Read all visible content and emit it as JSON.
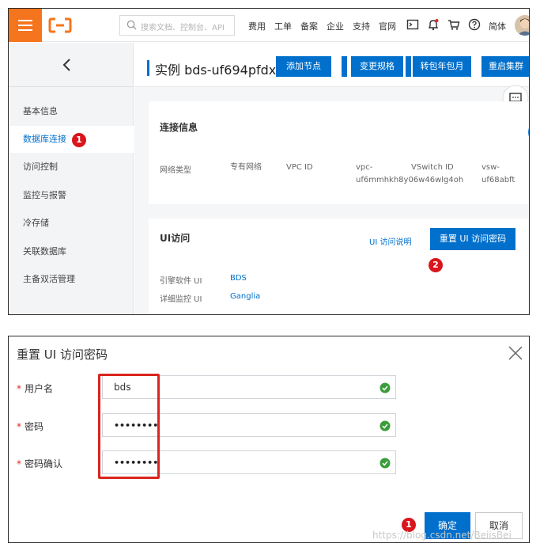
{
  "topnav": {
    "search_placeholder": "搜索文档、控制台、API",
    "links": [
      "费用",
      "工单",
      "备案",
      "企业",
      "支持",
      "官网"
    ],
    "lang": "简体",
    "icons": [
      "terminal-icon",
      "bell-icon",
      "cart-icon",
      "help-icon"
    ]
  },
  "sidebar": {
    "items": [
      {
        "label": "基本信息"
      },
      {
        "label": "数据库连接"
      },
      {
        "label": "访问控制"
      },
      {
        "label": "监控与报警"
      },
      {
        "label": "冷存储"
      },
      {
        "label": "关联数据库"
      },
      {
        "label": "主备双活管理"
      }
    ],
    "active_index": 1
  },
  "header": {
    "instance_title": "实例 bds-uf694pfdx5i5",
    "buttons": {
      "add_node": "添加节点",
      "change_spec": "变更规格",
      "to_annual": "转包年包月",
      "restart": "重启集群"
    }
  },
  "connection": {
    "title": "连接信息",
    "network_type_label": "网络类型",
    "network_type_value": "专有网络",
    "vpc_label": "VPC ID",
    "vpc_value_1": "vpc-",
    "vpc_value_2": "uf6mmhkh8y06w46wlg4oh",
    "vswitch_label": "VSwitch ID",
    "vswitch_value_1": "vsw-",
    "vswitch_value_2": "uf68abft"
  },
  "ui_access": {
    "title": "UI访问",
    "help_link": "UI 访问说明",
    "reset_button": "重置 UI 访问密码",
    "engine_label": "引擎软件 UI",
    "engine_value": "BDS",
    "monitor_label": "详细监控 UI",
    "monitor_value": "Ganglia"
  },
  "badges": {
    "b1": "1",
    "b2": "2",
    "b3": "1"
  },
  "dialog": {
    "title": "重置 UI 访问密码",
    "required_mark": "*",
    "username_label": "用户名",
    "username_value": "bds",
    "password_label": "密码",
    "password_value": "••••••••",
    "confirm_label": "密码确认",
    "confirm_value": "••••••••",
    "ok": "确定",
    "cancel": "取消"
  },
  "watermark": "https://blog.csdn.net/BeiisBei",
  "colors": {
    "accent": "#0070cc",
    "brand_orange": "#f5751e",
    "badge_red": "#d9161c",
    "success_green": "#3a9d3a"
  }
}
